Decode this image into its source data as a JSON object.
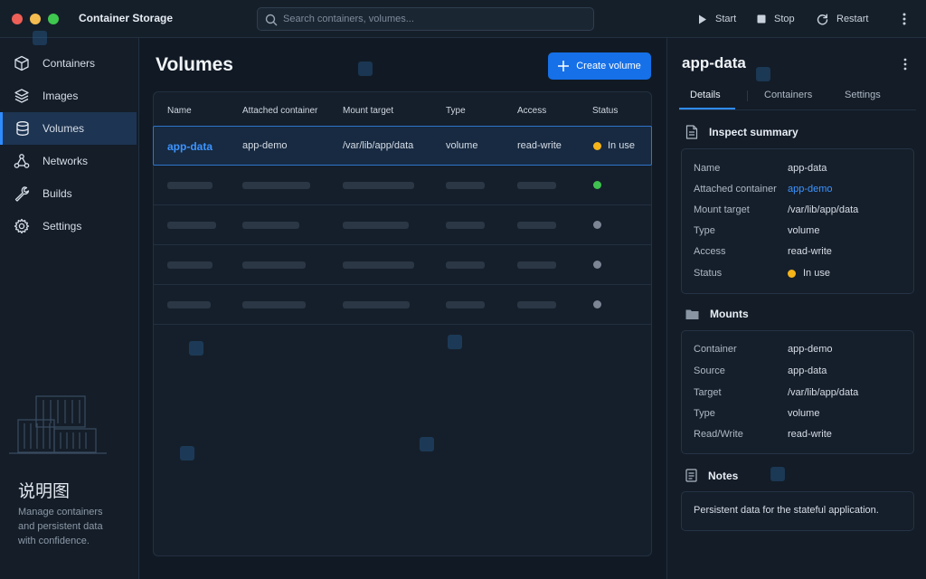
{
  "app": {
    "title": "Container Storage"
  },
  "search": {
    "placeholder": "Search containers, volumes..."
  },
  "toolbar": {
    "start_label": "Start",
    "stop_label": "Stop",
    "restart_label": "Restart"
  },
  "sidebar": {
    "items": [
      {
        "label": "Containers",
        "icon": "cube-icon",
        "active": false
      },
      {
        "label": "Images",
        "icon": "layers-icon",
        "active": false
      },
      {
        "label": "Volumes",
        "icon": "database-icon",
        "active": true
      },
      {
        "label": "Networks",
        "icon": "network-icon",
        "active": false
      },
      {
        "label": "Builds",
        "icon": "wrench-icon",
        "active": false
      },
      {
        "label": "Settings",
        "icon": "gear-icon",
        "active": false
      }
    ],
    "footer_title": "说明图",
    "footer_desc": "Manage containers and persistent data with confidence."
  },
  "main": {
    "title": "Volumes",
    "create_label": "Create volume",
    "columns": [
      "Name",
      "Attached container",
      "Mount target",
      "Type",
      "Access",
      "Status"
    ],
    "rows": [
      {
        "name": "app-data",
        "container": "app-demo",
        "mount": "/var/lib/app/data",
        "type": "volume",
        "access": "read-write",
        "status": "In use",
        "status_color": "#f5b418"
      }
    ],
    "placeholder_status_colors": [
      "#3fc24f",
      "#7b8594",
      "#7b8594",
      "#7b8594"
    ]
  },
  "panel": {
    "title": "app-data",
    "tabs": [
      "Details",
      "Containers",
      "Settings"
    ],
    "summary_title": "Inspect summary",
    "summary": [
      {
        "key": "Name",
        "value": "app-data"
      },
      {
        "key": "Attached container",
        "value": "app-demo"
      },
      {
        "key": "Mount target",
        "value": "/var/lib/app/data"
      },
      {
        "key": "Type",
        "value": "volume"
      },
      {
        "key": "Access",
        "value": "read-write"
      },
      {
        "key": "Status",
        "value": "In use"
      }
    ],
    "mounts_title": "Mounts",
    "mounts": [
      {
        "key": "Container",
        "value": "app-demo"
      },
      {
        "key": "Source",
        "value": "app-data"
      },
      {
        "key": "Target",
        "value": "/var/lib/app/data"
      },
      {
        "key": "Type",
        "value": "volume"
      },
      {
        "key": "Read/Write",
        "value": "read-write"
      }
    ],
    "notes_title": "Notes",
    "notes": "Persistent data for the stateful application."
  },
  "colors": {
    "accent": "#2f8cff",
    "in_use": "#f5b418",
    "running": "#3fc24f",
    "idle": "#7b8594"
  }
}
